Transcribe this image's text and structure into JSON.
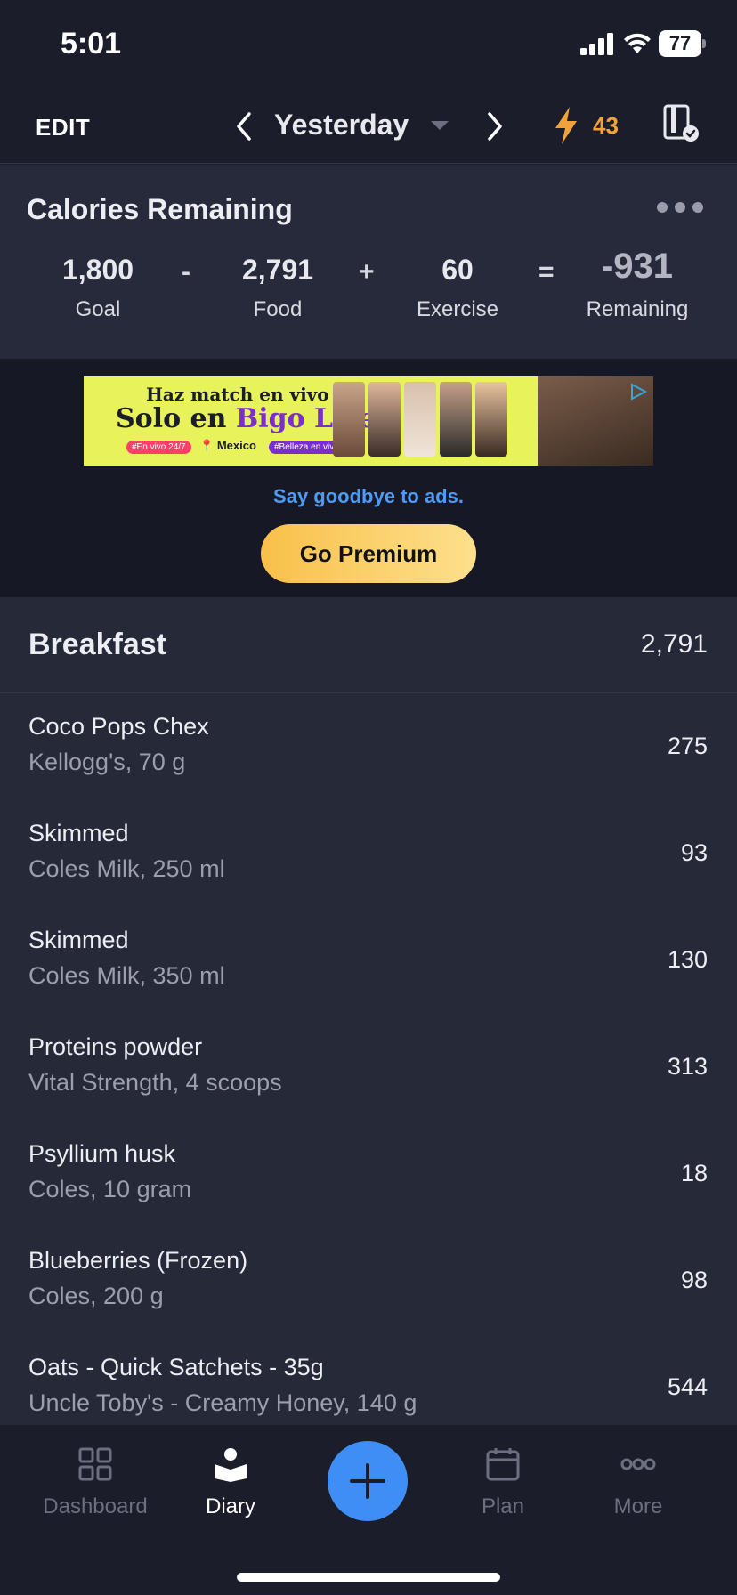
{
  "status_bar": {
    "time": "5:01",
    "battery": "77"
  },
  "header": {
    "edit_label": "EDIT",
    "date_label": "Yesterday",
    "streak_count": "43"
  },
  "calories": {
    "title": "Calories Remaining",
    "goal": {
      "value": "1,800",
      "label": "Goal"
    },
    "food": {
      "value": "2,791",
      "label": "Food"
    },
    "exercise": {
      "value": "60",
      "label": "Exercise"
    },
    "remaining": {
      "value": "-931",
      "label": "Remaining"
    },
    "ops": {
      "minus": "-",
      "plus": "+",
      "equals": "="
    }
  },
  "ad": {
    "line1": "Haz match en vivo",
    "line2_prefix": "Solo en ",
    "line2_brand": "Bigo Live.",
    "location": "Mexico",
    "cta_text": "Say goodbye to ads.",
    "premium_label": "Go Premium"
  },
  "meal": {
    "title": "Breakfast",
    "total": "2,791",
    "items": [
      {
        "name": "Coco Pops Chex",
        "desc": "Kellogg's, 70 g",
        "cal": "275"
      },
      {
        "name": "Skimmed",
        "desc": "Coles Milk, 250 ml",
        "cal": "93"
      },
      {
        "name": "Skimmed",
        "desc": "Coles Milk, 350 ml",
        "cal": "130"
      },
      {
        "name": "Proteins powder",
        "desc": "Vital Strength, 4 scoops",
        "cal": "313"
      },
      {
        "name": "Psyllium husk",
        "desc": "Coles, 10 gram",
        "cal": "18"
      },
      {
        "name": "Blueberries (Frozen)",
        "desc": "Coles, 200 g",
        "cal": "98"
      },
      {
        "name": "Oats - Quick Satchets - 35g",
        "desc": "Uncle Toby's - Creamy Honey, 140 g",
        "cal": "544"
      }
    ]
  },
  "tabs": {
    "dashboard": "Dashboard",
    "diary": "Diary",
    "plan": "Plan",
    "more": "More"
  },
  "colors": {
    "background": "#1b1d2a",
    "card": "#272a3a",
    "accent_blue": "#3e8ef5",
    "streak_orange": "#f2a23b",
    "premium_gold": "#f9c04a"
  },
  "icons": {
    "back": "chevron-left-icon",
    "forward": "chevron-right-icon",
    "streak": "lightning-icon",
    "report": "report-check-icon",
    "add": "plus-icon"
  }
}
